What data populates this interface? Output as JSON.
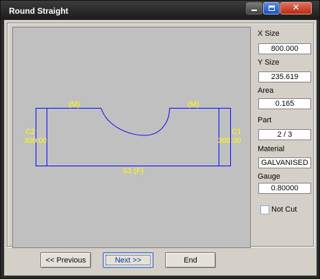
{
  "window": {
    "title": "Round Straight"
  },
  "titlebar": {
    "close_glyph": "✕"
  },
  "drawing": {
    "stroke_color": "#0000ff",
    "label_color": "#ffff00",
    "labels": {
      "top_left": "(M)",
      "top_right": "(M)",
      "left_name": "C2",
      "left_value": "300.00",
      "right_name": "C1",
      "right_value": "300.00",
      "bottom": "S1 (F)"
    }
  },
  "properties": {
    "x_size_label": "X Size",
    "x_size_value": "800.000",
    "y_size_label": "Y Size",
    "y_size_value": "235.619",
    "area_label": "Area",
    "area_value": "0.165",
    "part_label": "Part",
    "part_value": "2 / 3",
    "material_label": "Material",
    "material_value": "GALVANISED",
    "gauge_label": "Gauge",
    "gauge_value": "0.80000",
    "not_cut_label": "Not Cut",
    "not_cut_checked": false
  },
  "buttons": {
    "previous": "<< Previous",
    "next": "Next >>",
    "end": "End"
  }
}
